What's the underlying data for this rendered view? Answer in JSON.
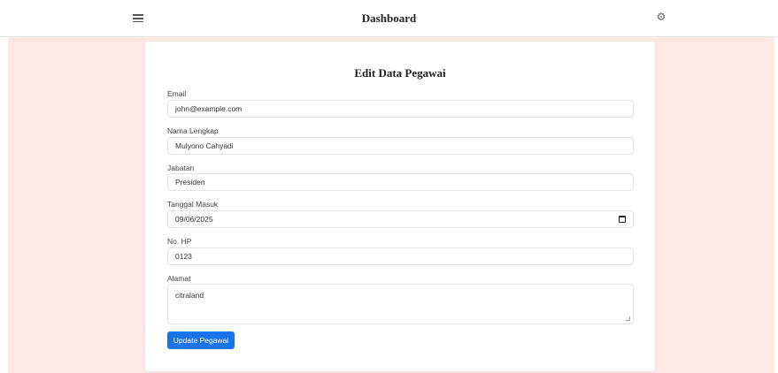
{
  "header": {
    "title": "Dashboard",
    "menu_icon": "hamburger-menu-icon",
    "settings_icon": "gear-icon"
  },
  "form": {
    "title": "Edit Data Pegawai",
    "fields": [
      {
        "label": "Email",
        "value": "john@example.com"
      },
      {
        "label": "Nama Lengkap",
        "value": "Mulyono Cahyadi"
      },
      {
        "label": "Jabatan",
        "value": "Presiden"
      },
      {
        "label": "Tanggal Masuk",
        "value": "09/06/2025"
      },
      {
        "label": "No. HP",
        "value": "0123"
      },
      {
        "label": "Alamat",
        "value": "citraland"
      }
    ],
    "submit_label": "Update Pegawai"
  },
  "colors": {
    "accent": "#1a73e8",
    "background": "#fde8e5"
  }
}
